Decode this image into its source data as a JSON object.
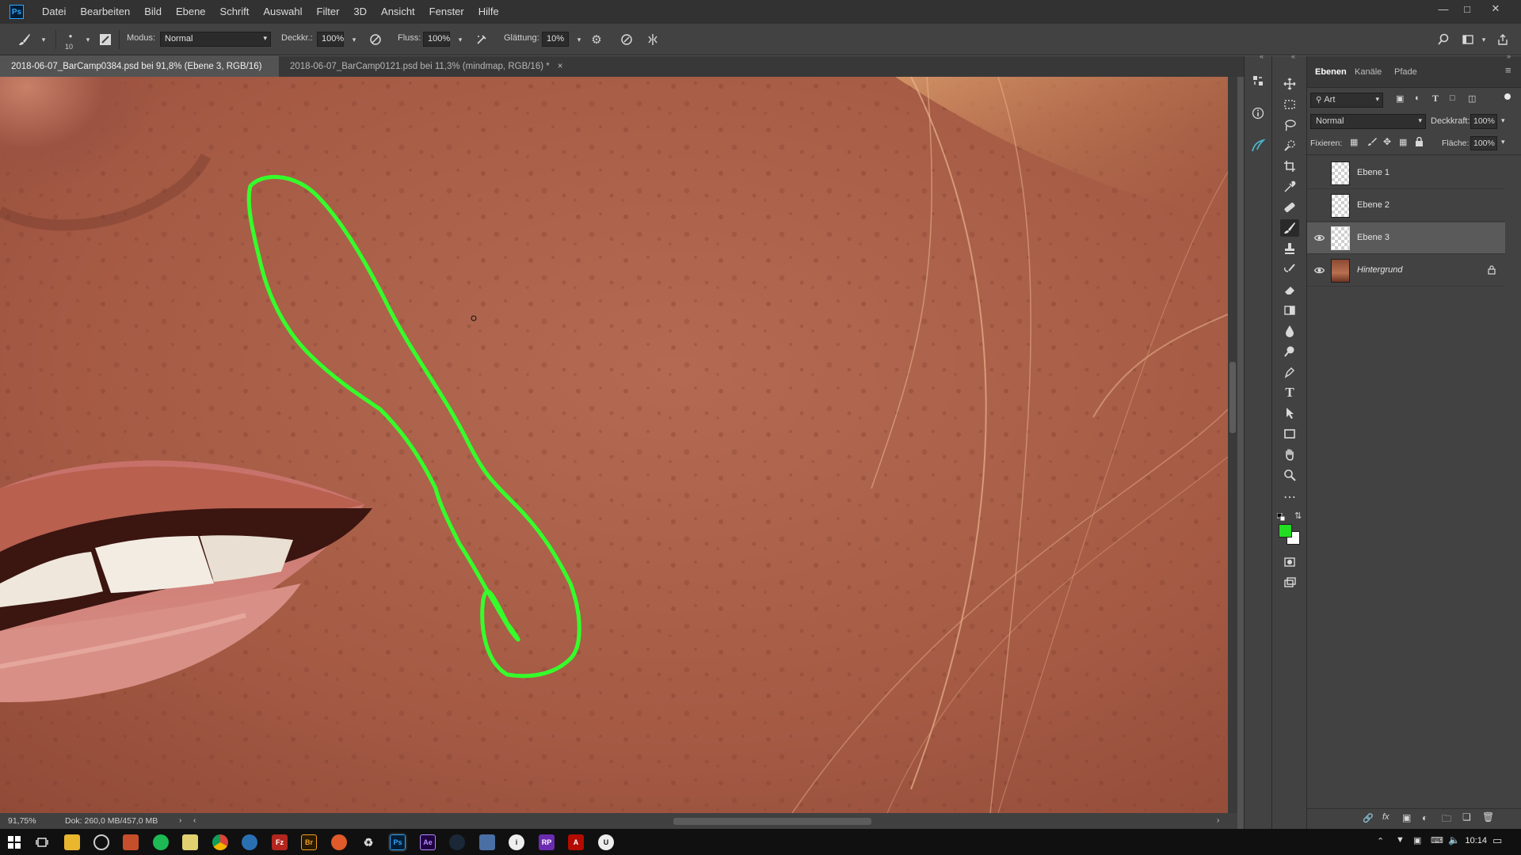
{
  "menubar": {
    "logo": "Ps",
    "items": [
      "Datei",
      "Bearbeiten",
      "Bild",
      "Ebene",
      "Schrift",
      "Auswahl",
      "Filter",
      "3D",
      "Ansicht",
      "Fenster",
      "Hilfe"
    ]
  },
  "options": {
    "brush_size": "10",
    "mode_label": "Modus:",
    "mode_value": "Normal",
    "opacity_label": "Deckkr.:",
    "opacity_value": "100%",
    "flow_label": "Fluss:",
    "flow_value": "100%",
    "smoothing_label": "Glättung:",
    "smoothing_value": "10%"
  },
  "tabs": [
    {
      "label": "2018-06-07_BarCamp0384.psd bei 91,8% (Ebene 3, RGB/16) *",
      "active": true
    },
    {
      "label": "2018-06-07_BarCamp0121.psd bei 11,3% (mindmap, RGB/16) *",
      "active": false
    }
  ],
  "tab_close": "×",
  "status": {
    "zoom": "91,75%",
    "doc": "Dok: 260,0 MB/457,0 MB"
  },
  "panel": {
    "tabs": [
      "Ebenen",
      "Kanäle",
      "Pfade"
    ],
    "filter_value": "Art",
    "blend_value": "Normal",
    "opacity_label": "Deckkraft:",
    "opacity_value": "100%",
    "lock_label": "Fixieren:",
    "fill_label": "Fläche:",
    "fill_value": "100%",
    "layers": [
      {
        "name": "Ebene 1",
        "visible": false,
        "selected": false
      },
      {
        "name": "Ebene 2",
        "visible": false,
        "selected": false
      },
      {
        "name": "Ebene 3",
        "visible": true,
        "selected": true
      },
      {
        "name": "Hintergrund",
        "visible": true,
        "selected": false
      }
    ]
  },
  "colors": {
    "foreground": "#22dd22",
    "background": "#ffffff",
    "selection_stroke": "#35ff2a"
  },
  "taskbar": {
    "time": "10:14"
  }
}
